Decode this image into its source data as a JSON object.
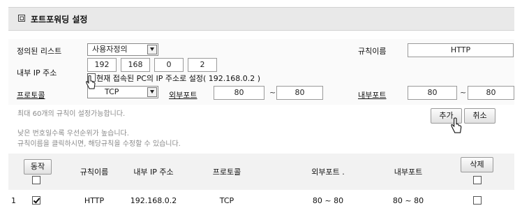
{
  "header": {
    "title": "포트포워딩 설정"
  },
  "form": {
    "defined_list_label": "정의된 리스트",
    "defined_list_value": "사용자정의",
    "rule_name_label": "규칙이름",
    "rule_name_value": "HTTP",
    "internal_ip_label": "내부 IP 주소",
    "ip_octets": [
      "192",
      "168",
      "0",
      "2"
    ],
    "current_pc_ip_text": "현재 접속된 PC의 IP 주소로 설정( 192.168.0.2 )",
    "protocol_label": "프로토콜",
    "protocol_value": "TCP",
    "external_port_label": "외부포트",
    "external_port_from": "80",
    "external_port_to": "80",
    "internal_port_label": "내부포트",
    "internal_port_from": "80",
    "internal_port_to": "80",
    "tilde": "~"
  },
  "info": {
    "max_rules": "최대 60개의 규칙이 설정가능합니다.",
    "priority": "낮은 번호일수록 우선순위가 높습니다.",
    "edit_hint": "규칙이름을 클릭하시면, 해당규칙을 수정할 수 있습니다."
  },
  "buttons": {
    "add": "추가",
    "cancel": "취소",
    "action": "동작",
    "delete": "삭제"
  },
  "table": {
    "headers": {
      "rule_name": "규칙이름",
      "internal_ip": "내부 IP 주소",
      "protocol": "프로토콜",
      "external_port": "외부포트 .",
      "internal_port": "내부포트"
    },
    "rows": [
      {
        "index": "1",
        "enabled": true,
        "rule_name": "HTTP",
        "internal_ip": "192.168.0.2",
        "protocol": "TCP",
        "external_port": "80 ~ 80",
        "internal_port": "80 ~ 80",
        "delete_checked": false
      }
    ]
  }
}
